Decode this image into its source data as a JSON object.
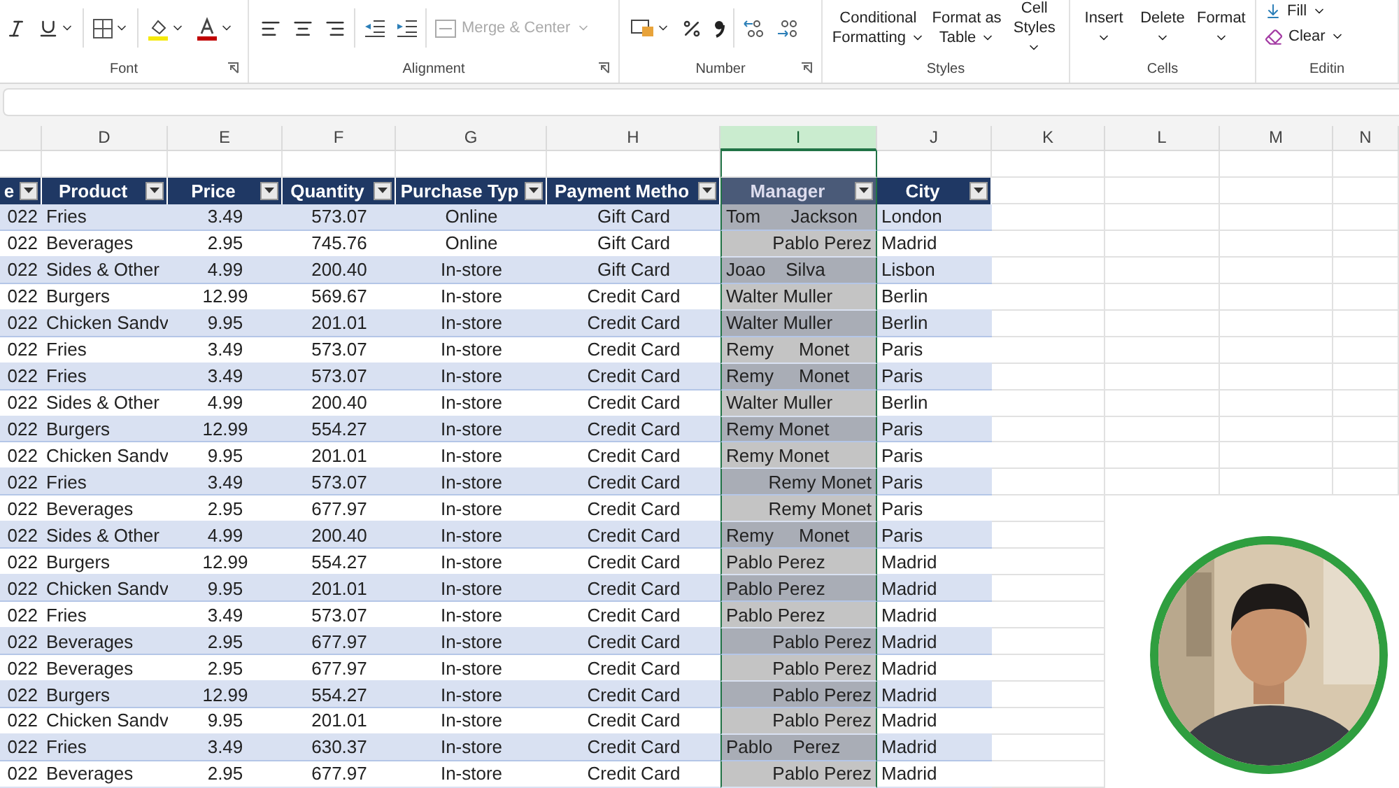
{
  "ribbon": {
    "groups": [
      {
        "kind": "font",
        "label": "Font"
      },
      {
        "kind": "alignment",
        "label": "Alignment",
        "merge": {
          "label": "Merge & Center",
          "disabled": true
        }
      },
      {
        "kind": "number",
        "label": "Number"
      },
      {
        "kind": "styles",
        "label": "Styles",
        "buttons": [
          "Conditional Formatting",
          "Format as Table",
          "Cell Styles"
        ]
      },
      {
        "kind": "cells",
        "label": "Cells",
        "buttons": [
          "Insert",
          "Delete",
          "Format"
        ]
      },
      {
        "kind": "editing",
        "label": "Editin",
        "buttons": [
          "Fill",
          "Clear"
        ]
      }
    ]
  },
  "sheet": {
    "columns": [
      {
        "label": "D",
        "selected": false
      },
      {
        "label": "E",
        "selected": false
      },
      {
        "label": "F",
        "selected": false
      },
      {
        "label": "G",
        "selected": false
      },
      {
        "label": "H",
        "selected": false
      },
      {
        "label": "I",
        "selected": true
      },
      {
        "label": "J",
        "selected": false
      },
      {
        "label": "K",
        "selected": false
      },
      {
        "label": "L",
        "selected": false
      },
      {
        "label": "M",
        "selected": false
      },
      {
        "label": "N",
        "selected": false
      }
    ],
    "headers": [
      "e",
      "Product",
      "Price",
      "Quantity",
      "Purchase Typ",
      "Payment Metho",
      "Manager",
      "City"
    ],
    "rows": [
      {
        "date": "022",
        "product": "Fries",
        "price": "3.49",
        "quantity": "573.07",
        "purchase_type": "Online",
        "payment_method": "Gift Card",
        "manager": {
          "text": "Tom      Jackson",
          "right_aligned": false
        },
        "city": "London"
      },
      {
        "date": "022",
        "product": "Beverages",
        "price": "2.95",
        "quantity": "745.76",
        "purchase_type": "Online",
        "payment_method": "Gift Card",
        "manager": {
          "text": "Pablo Perez",
          "right_aligned": true
        },
        "city": "Madrid"
      },
      {
        "date": "022",
        "product": "Sides & Other",
        "price": "4.99",
        "quantity": "200.40",
        "purchase_type": "In-store",
        "payment_method": "Gift Card",
        "manager": {
          "text": "Joao    Silva",
          "right_aligned": false
        },
        "city": "Lisbon"
      },
      {
        "date": "022",
        "product": "Burgers",
        "price": "12.99",
        "quantity": "569.67",
        "purchase_type": "In-store",
        "payment_method": "Credit Card",
        "manager": {
          "text": "Walter Muller",
          "right_aligned": false
        },
        "city": "Berlin"
      },
      {
        "date": "022",
        "product": "Chicken Sandv",
        "price": "9.95",
        "quantity": "201.01",
        "purchase_type": "In-store",
        "payment_method": "Credit Card",
        "manager": {
          "text": "Walter Muller",
          "right_aligned": false
        },
        "city": "Berlin"
      },
      {
        "date": "022",
        "product": "Fries",
        "price": "3.49",
        "quantity": "573.07",
        "purchase_type": "In-store",
        "payment_method": "Credit Card",
        "manager": {
          "text": "Remy     Monet",
          "right_aligned": false
        },
        "city": "Paris"
      },
      {
        "date": "022",
        "product": "Fries",
        "price": "3.49",
        "quantity": "573.07",
        "purchase_type": "In-store",
        "payment_method": "Credit Card",
        "manager": {
          "text": "Remy     Monet",
          "right_aligned": false
        },
        "city": "Paris"
      },
      {
        "date": "022",
        "product": "Sides & Other",
        "price": "4.99",
        "quantity": "200.40",
        "purchase_type": "In-store",
        "payment_method": "Credit Card",
        "manager": {
          "text": "Walter Muller",
          "right_aligned": false
        },
        "city": "Berlin"
      },
      {
        "date": "022",
        "product": "Burgers",
        "price": "12.99",
        "quantity": "554.27",
        "purchase_type": "In-store",
        "payment_method": "Credit Card",
        "manager": {
          "text": "Remy Monet",
          "right_aligned": false
        },
        "city": "Paris"
      },
      {
        "date": "022",
        "product": "Chicken Sandv",
        "price": "9.95",
        "quantity": "201.01",
        "purchase_type": "In-store",
        "payment_method": "Credit Card",
        "manager": {
          "text": "Remy Monet",
          "right_aligned": false
        },
        "city": "Paris"
      },
      {
        "date": "022",
        "product": "Fries",
        "price": "3.49",
        "quantity": "573.07",
        "purchase_type": "In-store",
        "payment_method": "Credit Card",
        "manager": {
          "text": "Remy Monet",
          "right_aligned": true
        },
        "city": "Paris"
      },
      {
        "date": "022",
        "product": "Beverages",
        "price": "2.95",
        "quantity": "677.97",
        "purchase_type": "In-store",
        "payment_method": "Credit Card",
        "manager": {
          "text": "Remy Monet",
          "right_aligned": true
        },
        "city": "Paris"
      },
      {
        "date": "022",
        "product": "Sides & Other",
        "price": "4.99",
        "quantity": "200.40",
        "purchase_type": "In-store",
        "payment_method": "Credit Card",
        "manager": {
          "text": "Remy     Monet",
          "right_aligned": false
        },
        "city": "Paris"
      },
      {
        "date": "022",
        "product": "Burgers",
        "price": "12.99",
        "quantity": "554.27",
        "purchase_type": "In-store",
        "payment_method": "Credit Card",
        "manager": {
          "text": "Pablo Perez",
          "right_aligned": false
        },
        "city": "Madrid"
      },
      {
        "date": "022",
        "product": "Chicken Sandv",
        "price": "9.95",
        "quantity": "201.01",
        "purchase_type": "In-store",
        "payment_method": "Credit Card",
        "manager": {
          "text": "Pablo Perez",
          "right_aligned": false
        },
        "city": "Madrid"
      },
      {
        "date": "022",
        "product": "Fries",
        "price": "3.49",
        "quantity": "573.07",
        "purchase_type": "In-store",
        "payment_method": "Credit Card",
        "manager": {
          "text": "Pablo Perez",
          "right_aligned": false
        },
        "city": "Madrid"
      },
      {
        "date": "022",
        "product": "Beverages",
        "price": "2.95",
        "quantity": "677.97",
        "purchase_type": "In-store",
        "payment_method": "Credit Card",
        "manager": {
          "text": "Pablo Perez",
          "right_aligned": true
        },
        "city": "Madrid"
      },
      {
        "date": "022",
        "product": "Beverages",
        "price": "2.95",
        "quantity": "677.97",
        "purchase_type": "In-store",
        "payment_method": "Credit Card",
        "manager": {
          "text": "Pablo Perez",
          "right_aligned": true
        },
        "city": "Madrid"
      },
      {
        "date": "022",
        "product": "Burgers",
        "price": "12.99",
        "quantity": "554.27",
        "purchase_type": "In-store",
        "payment_method": "Credit Card",
        "manager": {
          "text": "Pablo Perez",
          "right_aligned": true
        },
        "city": "Madrid"
      },
      {
        "date": "022",
        "product": "Chicken Sandv",
        "price": "9.95",
        "quantity": "201.01",
        "purchase_type": "In-store",
        "payment_method": "Credit Card",
        "manager": {
          "text": "Pablo Perez",
          "right_aligned": true
        },
        "city": "Madrid"
      },
      {
        "date": "022",
        "product": "Fries",
        "price": "3.49",
        "quantity": "630.37",
        "purchase_type": "In-store",
        "payment_method": "Credit Card",
        "manager": {
          "text": "Pablo    Perez",
          "right_aligned": false
        },
        "city": "Madrid"
      },
      {
        "date": "022",
        "product": "Beverages",
        "price": "2.95",
        "quantity": "677.97",
        "purchase_type": "In-store",
        "payment_method": "Credit Card",
        "manager": {
          "text": "Pablo Perez",
          "right_aligned": true
        },
        "city": "Madrid"
      }
    ]
  }
}
